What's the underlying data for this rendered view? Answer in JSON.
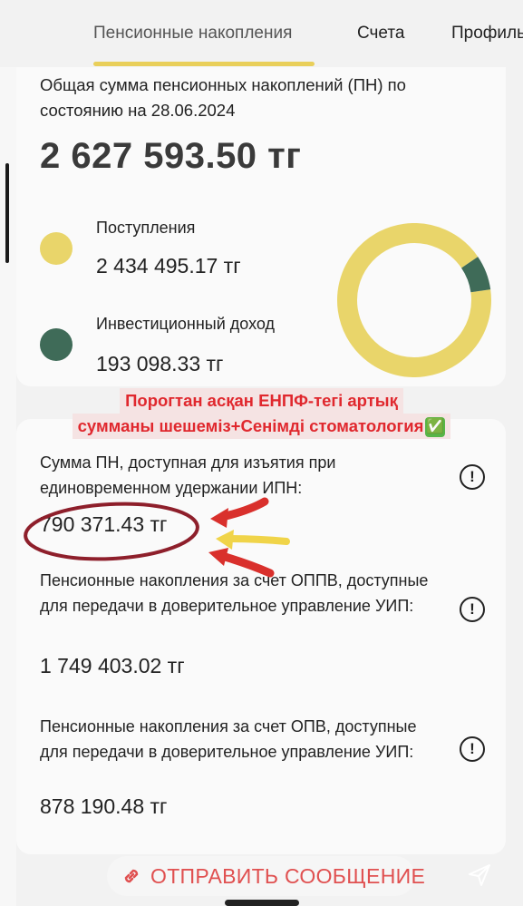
{
  "tabs": [
    {
      "label": "Пенсионные накопления"
    },
    {
      "label": "Счета"
    },
    {
      "label": "Профиль"
    }
  ],
  "summary": {
    "label": "Общая сумма пенсионных накоплений (ПН) по состоянию на 28.06.2024",
    "amount": "2 627 593.50 тг",
    "items": [
      {
        "label": "Поступления",
        "value": "2 434 495.17 тг",
        "color": "#e9d56a"
      },
      {
        "label": "Инвестиционный доход",
        "value": "193 098.33 тг",
        "color": "#3f6b58"
      }
    ],
    "donut": {
      "values": [
        2434495.17,
        193098.33
      ],
      "colors": [
        "#e9d56a",
        "#3f6b58"
      ]
    }
  },
  "caption": {
    "line1": "Порогтан асқан ЕНПФ-тегі артық",
    "line2": "сумманы шешеміз+Сенімді стоматология",
    "emoji": "✅"
  },
  "details": [
    {
      "label": "Сумма ПН, доступная для изъятия при единовременном удержании ИПН:",
      "value": "790 371.43 тг",
      "icon": "info-icon"
    },
    {
      "label": "Пенсионные накопления за счет ОППВ, доступные для передачи в доверительное управление УИП:",
      "value": "1 749 403.02 тг",
      "icon": "info-icon"
    },
    {
      "label": "Пенсионные накопления за счет ОПВ, доступные для передачи в доверительное управление УИП:",
      "value": "878 190.48 тг",
      "icon": "info-icon"
    }
  ],
  "bottom": {
    "send_label": "ОТПРАВИТЬ СООБЩЕНИЕ",
    "link_icon": "link-icon",
    "send_icon": "paper-plane-icon"
  },
  "colors": {
    "accent": "#e9cf5a",
    "caption_text": "#e0282e",
    "annotation_red": "#8e1f2b",
    "annotation_arrow_red": "#d9302c",
    "annotation_arrow_yellow": "#f0d449"
  }
}
